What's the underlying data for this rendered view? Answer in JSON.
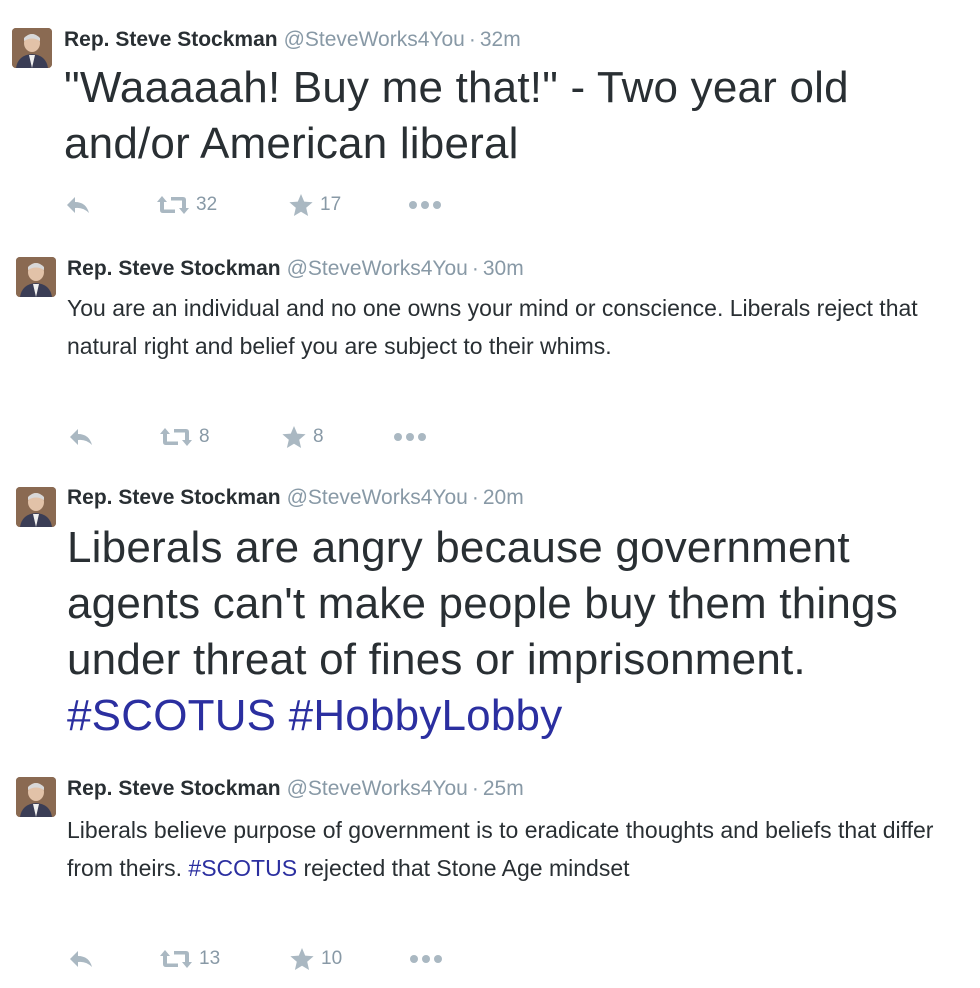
{
  "tweets": [
    {
      "name": "Rep. Steve Stockman",
      "handle": "@SteveWorks4You",
      "separator": "·",
      "time": "32m",
      "text_parts": [
        "\"Waaaaah! Buy me that!\" - Two year old and/or American liberal"
      ],
      "retweets": "32",
      "favorites": "17"
    },
    {
      "name": "Rep. Steve Stockman",
      "handle": "@SteveWorks4You",
      "separator": "·",
      "time": "30m",
      "text_parts": [
        "You are an individual and no one owns your mind or conscience. Liberals reject that natural right and belief you are subject to their whims."
      ],
      "retweets": "8",
      "favorites": "8"
    },
    {
      "name": "Rep. Steve Stockman",
      "handle": "@SteveWorks4You",
      "separator": "·",
      "time": "20m",
      "text_parts": [
        "Liberals are angry because government agents can't make people buy them things under threat of fines or imprisonment.",
        "#SCOTUS",
        "#HobbyLobby"
      ]
    },
    {
      "name": "Rep. Steve Stockman",
      "handle": "@SteveWorks4You",
      "separator": "·",
      "time": "25m",
      "text_parts": [
        "Liberals believe purpose of government is to eradicate thoughts and beliefs that differ from theirs.",
        "#SCOTUS",
        "rejected that Stone Age mindset"
      ],
      "retweets": "13",
      "favorites": "10"
    }
  ],
  "icons": {
    "reply": "reply-icon",
    "retweet": "retweet-icon",
    "favorite": "star-icon",
    "more": "more-dots-icon"
  },
  "colors": {
    "name": "#292f33",
    "meta": "#8899a6",
    "hashtag": "#2b2fa0",
    "action_icon": "#aab8c2"
  }
}
